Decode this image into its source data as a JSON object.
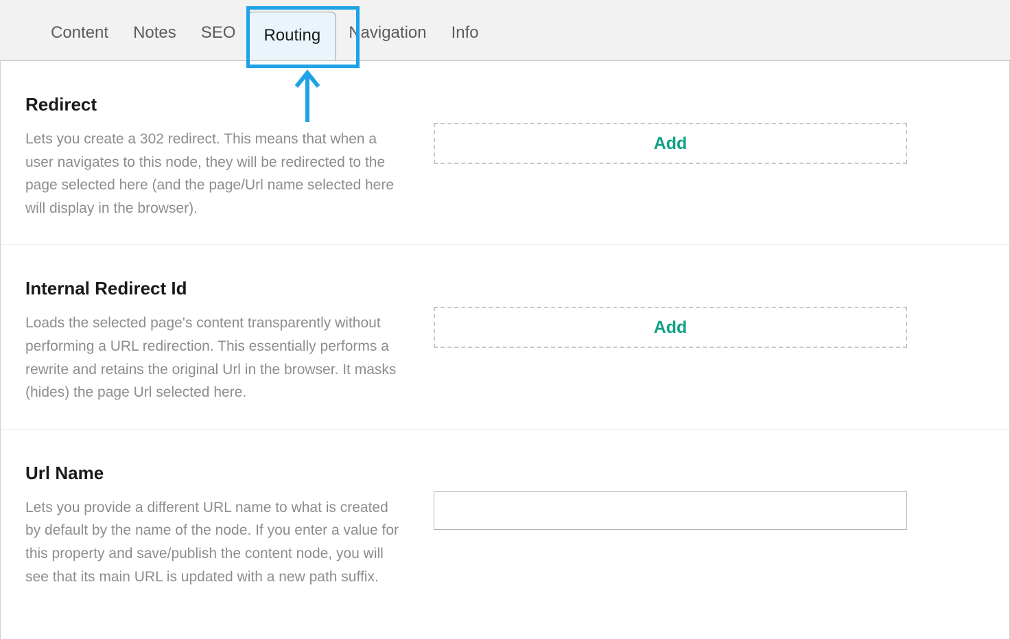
{
  "tabs": [
    {
      "label": "Content"
    },
    {
      "label": "Notes"
    },
    {
      "label": "SEO"
    },
    {
      "label": "Routing"
    },
    {
      "label": "Navigation"
    },
    {
      "label": "Info"
    }
  ],
  "sections": {
    "redirect": {
      "title": "Redirect",
      "desc": "Lets you create a 302 redirect. This means that when a user navigates to this node, they will be redirected to the page selected here (and the page/Url name selected here will display in the browser).",
      "button": "Add"
    },
    "internal": {
      "title": "Internal Redirect Id",
      "desc": "Loads the selected page's content transparently without performing a URL redirection. This essentially performs a rewrite and retains the original Url in the browser. It masks (hides) the page Url selected here.",
      "button": "Add"
    },
    "urlname": {
      "title": "Url Name",
      "desc": "Lets you provide a different URL name to what is created by default by the name of the node. If you enter a value for this property and save/publish the content node, you will see that its main URL is updated with a new path suffix.",
      "value": ""
    }
  }
}
